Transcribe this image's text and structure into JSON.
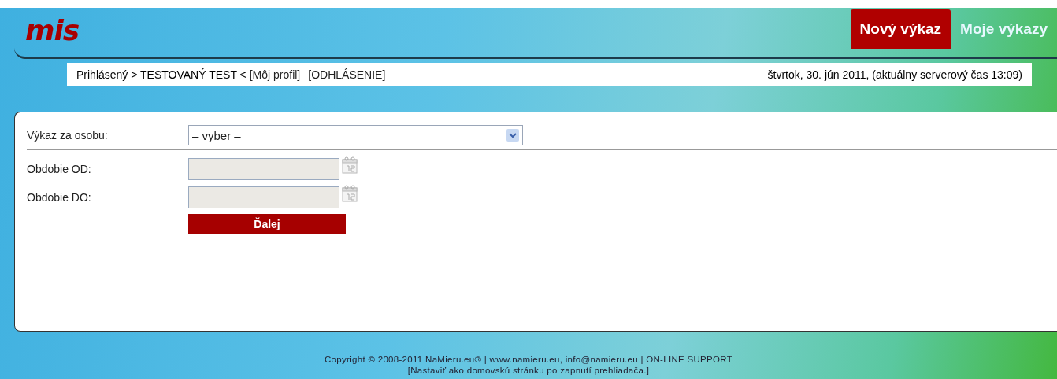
{
  "header": {
    "logo": "mis",
    "nav": [
      {
        "label": "Nový výkaz",
        "selected": true
      },
      {
        "label": "Moje výkazy",
        "selected": false
      }
    ],
    "user_bar": {
      "prefix": "Prihlásený > TESTOVANÝ TEST < ",
      "profile_link": "[Môj profil]",
      "logout_link": "[ODHLÁSENIE]",
      "date": "štvrtok, 30. jún 2011, (aktuálny serverový čas 13:09)"
    }
  },
  "form": {
    "fields": [
      {
        "kind": "select",
        "label": "Výkaz za osobu:",
        "value": "– vyber –"
      },
      {
        "kind": "date",
        "label": "Obdobie OD:"
      },
      {
        "kind": "date",
        "label": "Obdobie DO:"
      }
    ],
    "submit": "Ďalej"
  },
  "footer": {
    "line_1": "Copyright © 2008-2011 NaMieru.eu® | www.namieru.eu, info@namieru.eu | ON-LINE SUPPORT",
    "line_2": "[Nastaviť ako domovskú stránku po zapnutí prehliadača.]"
  }
}
